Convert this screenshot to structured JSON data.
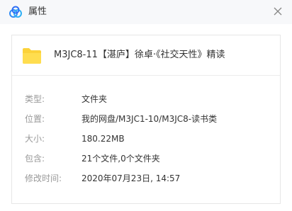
{
  "window": {
    "title": "属性",
    "app_icon": "baidu-netdisk-cloud-icon",
    "close_icon": "close-icon",
    "accent_color": "#2f8cf5"
  },
  "file": {
    "icon": "folder-icon",
    "icon_color": "#fcd23a",
    "name": "M3JC8-11【湛庐】徐卓·《社交天性》精读"
  },
  "properties": [
    {
      "label": "类型:",
      "value": "文件夹"
    },
    {
      "label": "位置:",
      "value": "我的网盘/M3JC1-10/M3JC8-读书类"
    },
    {
      "label": "大小:",
      "value": "180.22MB"
    },
    {
      "label": "包含:",
      "value": "21个文件,0个文件夹"
    },
    {
      "label": "修改时间:",
      "value": "2020年07月23日, 14:57"
    }
  ]
}
